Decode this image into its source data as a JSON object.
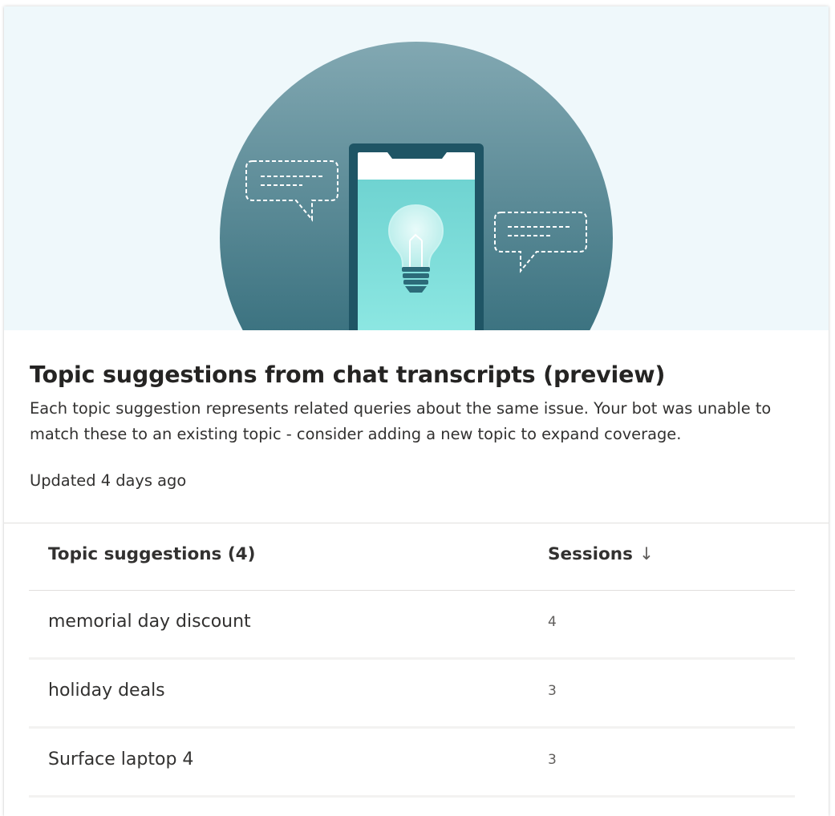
{
  "card": {
    "title": "Topic suggestions from chat transcripts (preview)",
    "description": "Each topic suggestion represents related queries about the same issue. Your bot was unable to match these to an existing topic - consider adding a new topic to expand coverage.",
    "updated": "Updated 4 days ago"
  },
  "illustration": {
    "icons": [
      "phone-icon",
      "lightbulb-icon",
      "chat-bubble-left-icon",
      "chat-bubble-right-icon"
    ],
    "colors": {
      "background": "#eff8fb",
      "circle_top": "#7fa5af",
      "circle_bottom": "#235f6e",
      "phone_screen": "#8de6e2"
    }
  },
  "table": {
    "header_topic": "Topic suggestions (4)",
    "header_sessions": "Sessions",
    "sort_icon": "↓",
    "rows": [
      {
        "topic": "memorial day discount",
        "sessions": "4"
      },
      {
        "topic": "holiday deals",
        "sessions": "3"
      },
      {
        "topic": "Surface laptop 4",
        "sessions": "3"
      }
    ]
  }
}
